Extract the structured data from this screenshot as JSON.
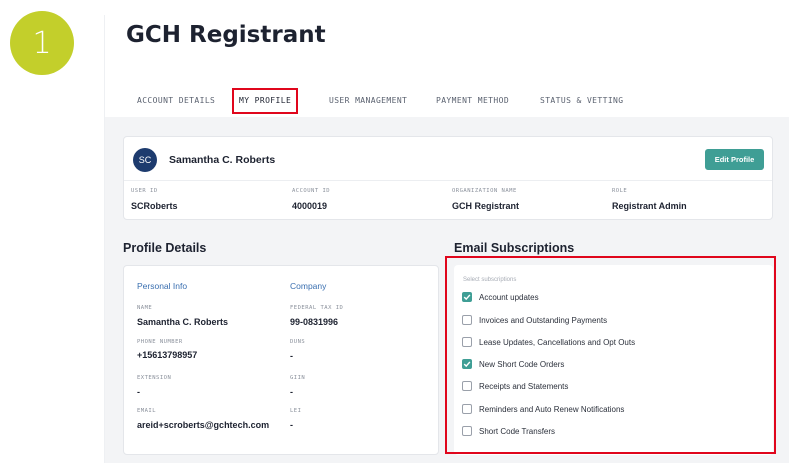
{
  "step_badge": "1",
  "page_title": "GCH Registrant",
  "tabs": [
    {
      "label": "ACCOUNT DETAILS"
    },
    {
      "label": "MY PROFILE"
    },
    {
      "label": "USER MANAGEMENT"
    },
    {
      "label": "PAYMENT METHOD"
    },
    {
      "label": "STATUS & VETTING"
    }
  ],
  "active_tab": "MY PROFILE",
  "user_card": {
    "avatar_initials": "SC",
    "name": "Samantha C. Roberts",
    "edit_label": "Edit Profile",
    "fields": [
      {
        "label": "USER ID",
        "value": "SCRoberts"
      },
      {
        "label": "ACCOUNT ID",
        "value": "4000019"
      },
      {
        "label": "ORGANIZATION NAME",
        "value": "GCH Registrant"
      },
      {
        "label": "ROLE",
        "value": "Registrant Admin"
      }
    ]
  },
  "profile_details": {
    "title": "Profile Details",
    "personal_heading": "Personal Info",
    "company_heading": "Company",
    "personal": [
      {
        "label": "NAME",
        "value": "Samantha C. Roberts"
      },
      {
        "label": "PHONE NUMBER",
        "value": "+15613798957"
      },
      {
        "label": "EXTENSION",
        "value": "-"
      },
      {
        "label": "EMAIL",
        "value": "areid+scroberts@gchtech.com"
      }
    ],
    "company": [
      {
        "label": "FEDERAL TAX ID",
        "value": "99-0831996"
      },
      {
        "label": "DUNS",
        "value": "-"
      },
      {
        "label": "GIIN",
        "value": "-"
      },
      {
        "label": "LEI",
        "value": "-"
      }
    ]
  },
  "email_subscriptions": {
    "title": "Email Subscriptions",
    "placeholder": "Select subscriptions",
    "items": [
      {
        "label": "Account updates",
        "checked": true
      },
      {
        "label": "Invoices and Outstanding Payments",
        "checked": false
      },
      {
        "label": "Lease Updates, Cancellations and Opt Outs",
        "checked": false
      },
      {
        "label": "New Short Code Orders",
        "checked": true
      },
      {
        "label": "Receipts and Statements",
        "checked": false
      },
      {
        "label": "Reminders and Auto Renew Notifications",
        "checked": false
      },
      {
        "label": "Short Code Transfers",
        "checked": false
      }
    ]
  },
  "colors": {
    "badge": "#c3cf2b",
    "accent_teal": "#3f9e95",
    "highlight_red": "#e0061c",
    "avatar_navy": "#1d3b6e",
    "link_blue": "#3a6fb0"
  }
}
